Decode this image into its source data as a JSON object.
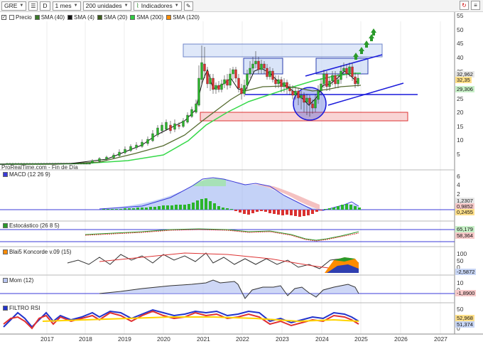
{
  "toolbar": {
    "symbol": "GRE",
    "period_btn": "D",
    "timeframe": "1 mes",
    "units": "200 unidades",
    "indicators_label": "Indicadores"
  },
  "legend": [
    {
      "label": "Precio",
      "color": "#ffffff"
    },
    {
      "label": "SMA (40)",
      "color": "#3a7a2a"
    },
    {
      "label": "SMA (4)",
      "color": "#111111"
    },
    {
      "label": "SMA (20)",
      "color": "#3d5e1d"
    },
    {
      "label": "SMA (200)",
      "color": "#2ecc40"
    },
    {
      "label": "SMA (120)",
      "color": "#ff8c00"
    }
  ],
  "source_label": "ProRealTime.com - Fin de Día",
  "price_axis": [
    "55",
    "50",
    "45",
    "40",
    "35",
    "30",
    "25",
    "20",
    "15",
    "10",
    "5"
  ],
  "price_tags": {
    "tag1": "32,962",
    "tag2": "32,35",
    "tag3": "29,306"
  },
  "panels": {
    "macd": {
      "label": "MACD (12 26 9)",
      "axis": [
        "6",
        "4",
        "2",
        "0"
      ],
      "tags": [
        "1,2307",
        "0,9852",
        "0,2455"
      ]
    },
    "stoch": {
      "label": "Estocástico (26 8 5)",
      "tags": [
        "65,179",
        "58,364"
      ]
    },
    "blai5": {
      "label": "Blai5 Koncorde v.09 (15)",
      "axis": [
        "100",
        "50",
        "0"
      ],
      "tag": "-2,5872"
    },
    "mom": {
      "label": "Mom (12)",
      "axis": [
        "10",
        "0"
      ],
      "tag": "-1,8900"
    },
    "rsi": {
      "label": "FILTRO RSI",
      "axis": [
        "50",
        "0"
      ],
      "tags": [
        "52,968",
        "51,374"
      ]
    }
  },
  "x_axis": [
    "2017",
    "2018",
    "2019",
    "2020",
    "2021",
    "2022",
    "2023",
    "2024",
    "2025",
    "2026",
    "2027"
  ],
  "colors": {
    "up": "#2bb52b",
    "down": "#d93030",
    "line_blue": "#1a1adb",
    "sma200": "#37d94a"
  }
}
